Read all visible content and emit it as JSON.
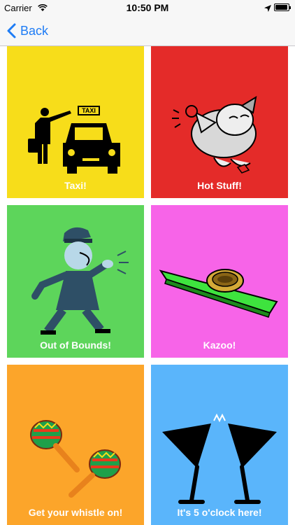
{
  "status_bar": {
    "carrier": "Carrier",
    "time": "10:50 PM"
  },
  "nav": {
    "back_label": "Back"
  },
  "tiles": [
    {
      "label": "Taxi!",
      "color": "#f7dd1a",
      "icon": "taxi-hailing-icon"
    },
    {
      "label": "Hot Stuff!",
      "color": "#e42b29",
      "icon": "cartoon-wolf-icon"
    },
    {
      "label": "Out of Bounds!",
      "color": "#5dd55b",
      "icon": "referee-whistle-icon"
    },
    {
      "label": "Kazoo!",
      "color": "#f764e8",
      "icon": "kazoo-icon"
    },
    {
      "label": "Get your whistle on!",
      "color": "#fca52a",
      "icon": "maracas-icon"
    },
    {
      "label": "It's 5 o'clock here!",
      "color": "#5ab5fb",
      "icon": "martini-glasses-icon"
    }
  ],
  "colors": {
    "accent": "#1e7cf5"
  }
}
